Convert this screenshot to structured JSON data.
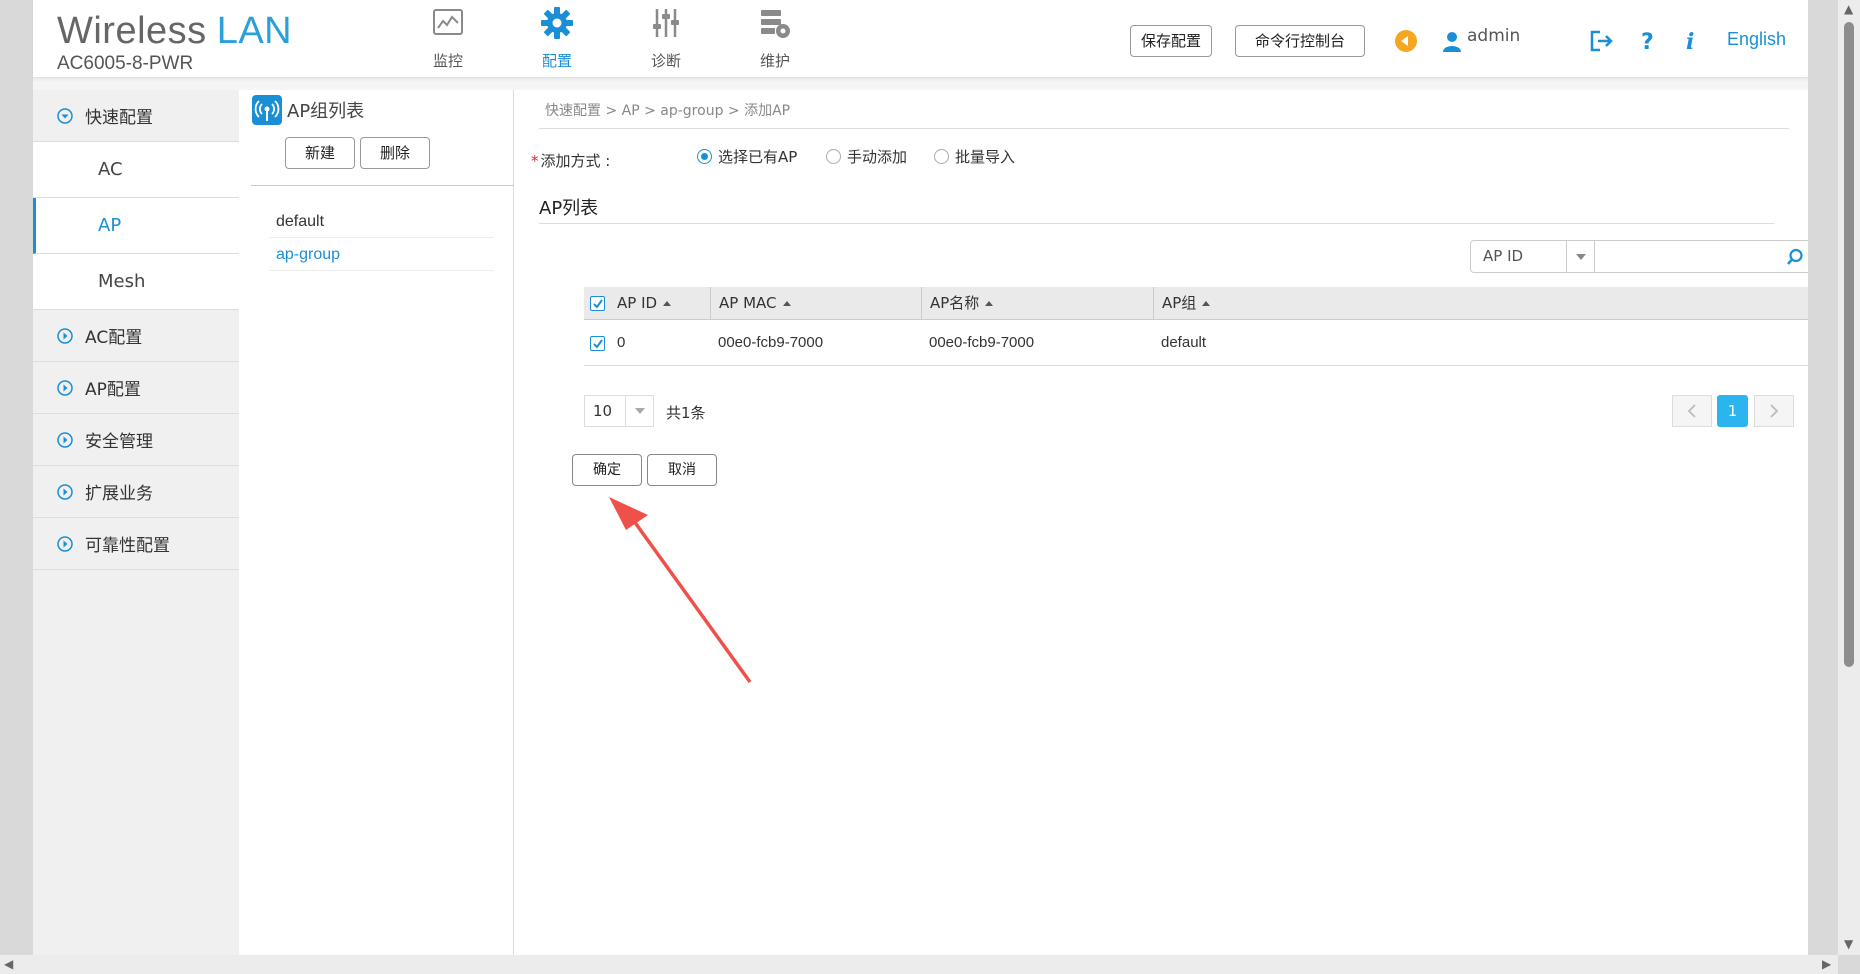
{
  "brand": {
    "title_a": "Wireless",
    "title_b": "LAN",
    "model": "AC6005-8-PWR"
  },
  "nav": [
    {
      "label": "监控",
      "icon": "monitor-icon"
    },
    {
      "label": "配置",
      "icon": "gear-icon",
      "active": true
    },
    {
      "label": "诊断",
      "icon": "sliders-icon"
    },
    {
      "label": "维护",
      "icon": "maintenance-icon"
    }
  ],
  "header": {
    "save_config": "保存配置",
    "cli_console": "命令行控制台",
    "user": "admin",
    "language": "English"
  },
  "sidebar": {
    "groups": [
      {
        "label": "快速配置",
        "expanded": true,
        "items": [
          "AC",
          "AP",
          "Mesh"
        ],
        "active_item": "AP"
      },
      {
        "label": "AC配置"
      },
      {
        "label": "AP配置"
      },
      {
        "label": "安全管理"
      },
      {
        "label": "扩展业务"
      },
      {
        "label": "可靠性配置"
      }
    ]
  },
  "group_panel": {
    "title": "AP组列表",
    "new_label": "新建",
    "delete_label": "删除",
    "items": [
      "default",
      "ap-group"
    ],
    "selected": "ap-group"
  },
  "content": {
    "breadcrumb": "快速配置 > AP > ap-group > 添加AP",
    "add_mode_label": "添加方式 :",
    "add_modes": [
      "选择已有AP",
      "手动添加",
      "批量导入"
    ],
    "selected_mode": "选择已有AP",
    "list_title": "AP列表",
    "filter_field": "AP ID",
    "search_value": "",
    "table": {
      "columns": [
        "AP ID",
        "AP MAC",
        "AP名称",
        "AP组"
      ],
      "rows": [
        {
          "checked": true,
          "cells": [
            "0",
            "00e0-fcb9-7000",
            "00e0-fcb9-7000",
            "default"
          ]
        }
      ]
    },
    "page_size": "10",
    "total": "共1条",
    "current_page": "1",
    "confirm_label": "确定",
    "cancel_label": "取消"
  },
  "colors": {
    "accent": "#1a8fd6",
    "page_active": "#2bb5ee",
    "arrow": "#f0504a",
    "warning": "#f5a623"
  }
}
